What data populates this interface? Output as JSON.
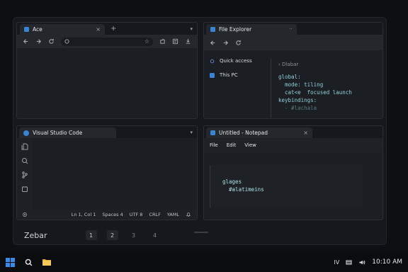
{
  "browser": {
    "tab_title": "Ace",
    "tab_close": "×",
    "new_tab": "+",
    "menu_caret": "▾"
  },
  "explorer": {
    "tab_title": "File Explorer",
    "tab_more": "··",
    "nav": [
      {
        "label": "Quick access"
      },
      {
        "label": "This PC"
      }
    ],
    "breadcrumb": "› Dlabar",
    "code_lines": [
      "global:",
      "  mode: tiling",
      "  cat<e  focused launch",
      "",
      "keybindings:",
      "  - #lachala"
    ]
  },
  "vscode": {
    "tab_title": "Visual Studio Code",
    "menu_caret": "▾",
    "status": {
      "position": "Ln 1, Col 1",
      "spaces": "Spaces 4",
      "encoding": "UTF 8",
      "eol": "CRLF",
      "language": "YAML"
    }
  },
  "notepad": {
    "tab_title": "Untitled - Notepad",
    "tab_close": "×",
    "menu": [
      "File",
      "Edit",
      "View"
    ],
    "content_lines": [
      "glages",
      "  #alatimeins"
    ]
  },
  "zebar": {
    "title": "Zebar",
    "workspaces": [
      "1",
      "2",
      "3",
      "4"
    ],
    "active_workspaces": [
      "1",
      "2"
    ]
  },
  "taskbar": {
    "tray_label": "IV",
    "clock": "10:10 AM"
  },
  "colors": {
    "accent": "#3a84d6",
    "code": "#8fd0d8",
    "window_bg": "#1b1e22",
    "taskbar_bg": "#0b0c0e"
  }
}
